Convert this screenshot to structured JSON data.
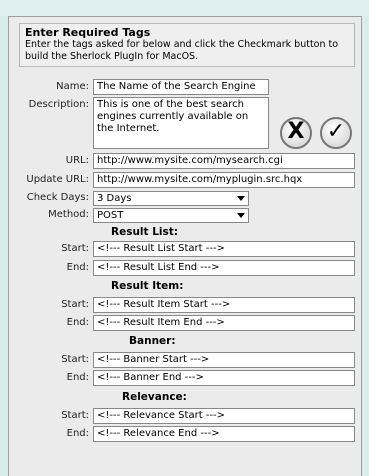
{
  "header": {
    "title": "Enter Required Tags",
    "description": "Enter the tags asked for below and click the Checkmark button to build the Sherlock PlugIn for MacOS."
  },
  "fields": {
    "name_label": "Name:",
    "name_value": "The Name of the Search Engine",
    "desc_label": "Description:",
    "desc_value": "This is one of the best search engines currently available on the Internet.",
    "url_label": "URL:",
    "url_value": "http://www.mysite.com/mysearch.cgi",
    "update_label": "Update URL:",
    "update_value": "http://www.mysite.com/myplugin.src.hqx",
    "check_label": "Check Days:",
    "check_value": "3 Days",
    "method_label": "Method:",
    "method_value": "POST"
  },
  "buttons": {
    "cancel_glyph": "X",
    "confirm_glyph": "✓"
  },
  "sections": {
    "result_list": {
      "title": "Result List:",
      "start_label": "Start:",
      "start_value": "<!--- Result List Start --->",
      "end_label": "End:",
      "end_value": "<!--- Result List End --->"
    },
    "result_item": {
      "title": "Result Item:",
      "start_label": "Start:",
      "start_value": "<!--- Result Item Start --->",
      "end_label": "End:",
      "end_value": "<!--- Result Item End --->"
    },
    "banner": {
      "title": "Banner:",
      "start_label": "Start:",
      "start_value": "<!--- Banner Start --->",
      "end_label": "End:",
      "end_value": "<!--- Banner End --->"
    },
    "relevance": {
      "title": "Relevance:",
      "start_label": "Start:",
      "start_value": "<!--- Relevance Start --->",
      "end_label": "End:",
      "end_value": "<!--- Relevance End --->"
    }
  }
}
